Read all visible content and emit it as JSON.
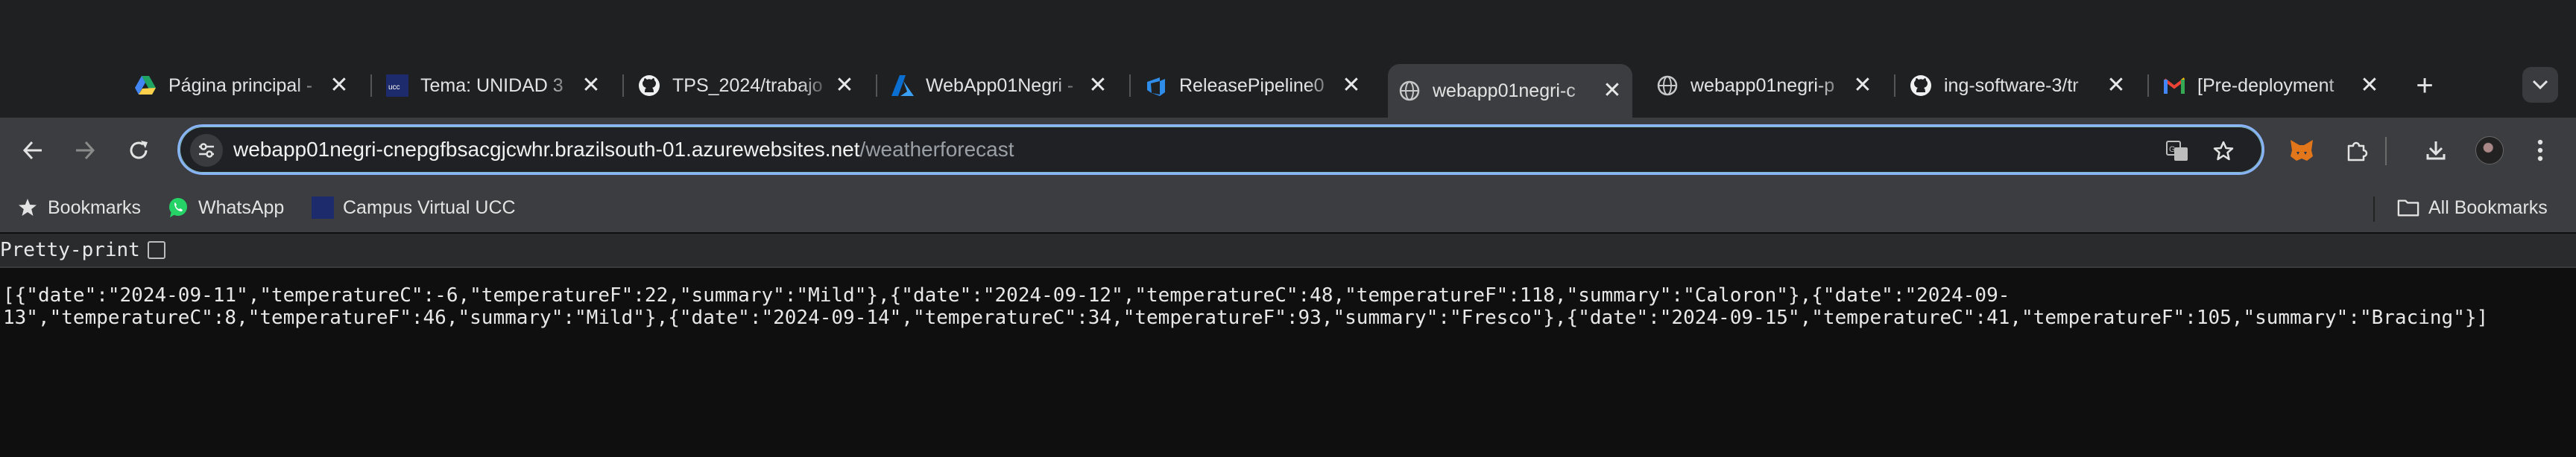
{
  "tabs": [
    {
      "title": "Página principal -",
      "icon": "google-drive-icon"
    },
    {
      "title": "Tema: UNIDAD 3",
      "icon": "ucc-icon"
    },
    {
      "title": "TPS_2024/trabajo",
      "icon": "github-icon"
    },
    {
      "title": "WebApp01Negri -",
      "icon": "azure-icon"
    },
    {
      "title": "ReleasePipeline0",
      "icon": "azure-devops-icon"
    },
    {
      "title": "webapp01negri-c",
      "icon": "globe-icon",
      "active": true
    },
    {
      "title": "webapp01negri-p",
      "icon": "globe-icon"
    },
    {
      "title": "ing-software-3/tr",
      "icon": "github-icon"
    },
    {
      "title": "[Pre-deployment",
      "icon": "gmail-icon"
    }
  ],
  "omnibox": {
    "host": "webapp01negri-cnepgfbsacgjcwhr.brazilsouth-01.azurewebsites.net",
    "path": "/weatherforecast"
  },
  "bookmarks": {
    "items": [
      {
        "label": "Bookmarks",
        "icon": "star-icon"
      },
      {
        "label": "WhatsApp",
        "icon": "whatsapp-icon"
      },
      {
        "label": "Campus Virtual UCC",
        "icon": "ucc-icon"
      }
    ],
    "all_label": "All Bookmarks"
  },
  "page": {
    "pretty_print_label": "Pretty-print",
    "json_line1": "[{\"date\":\"2024-09-11\",\"temperatureC\":-6,\"temperatureF\":22,\"summary\":\"Mild\"},{\"date\":\"2024-09-12\",\"temperatureC\":48,\"temperatureF\":118,\"summary\":\"Caloron\"},{\"date\":\"2024-09-",
    "json_line2": "13\",\"temperatureC\":8,\"temperatureF\":46,\"summary\":\"Mild\"},{\"date\":\"2024-09-14\",\"temperatureC\":34,\"temperatureF\":93,\"summary\":\"Fresco\"},{\"date\":\"2024-09-15\",\"temperatureC\":41,\"temperatureF\":105,\"summary\":\"Bracing\"}]"
  },
  "colors": {
    "tabstrip_bg": "#1f2022",
    "toolbar_bg": "#3c3d40",
    "omnibox_border": "#8ab4f8",
    "page_bg": "#0f0f10"
  }
}
